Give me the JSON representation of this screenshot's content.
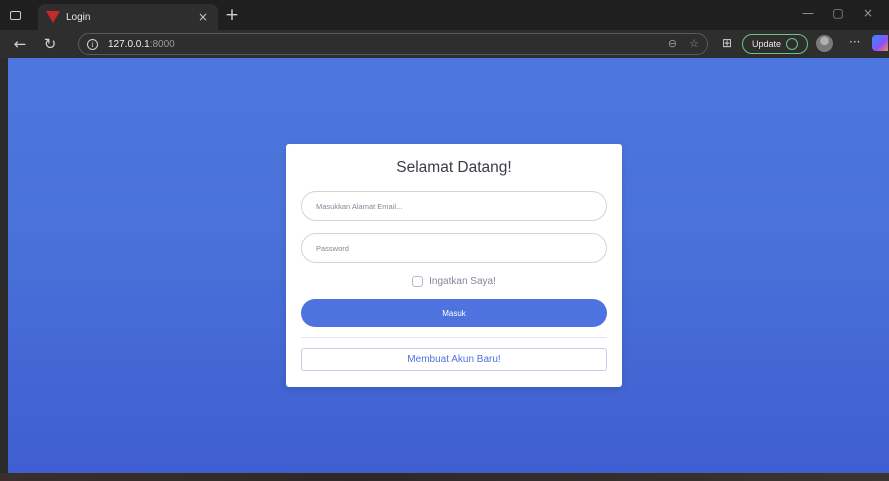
{
  "browser": {
    "tab": {
      "title": "Login",
      "close_glyph": "×"
    },
    "new_tab_glyph": "+",
    "address": {
      "host": "127.0.0.1",
      "port": ":8000"
    },
    "update_label": "Update",
    "window_controls": {
      "minimize": "—",
      "restore": "▢",
      "close": "×"
    },
    "icons": {
      "back": "←",
      "reload": "↻",
      "zoom": "⊖",
      "favorite": "☆",
      "collections": "⊞",
      "more": "···",
      "info": "i"
    }
  },
  "page": {
    "title": "Selamat Datang!",
    "email": {
      "placeholder": "Masukkan Alamat Email...",
      "value": ""
    },
    "password": {
      "placeholder": "Password",
      "value": ""
    },
    "remember_label": "Ingatkan Saya!",
    "login_button": "Masuk",
    "register_button": "Membuat Akun Baru!"
  },
  "colors": {
    "primary": "#4e73df",
    "background_top": "#4d77de",
    "background_bottom": "#3f5ed1",
    "card": "#ffffff",
    "update_accent": "#6ec28a"
  }
}
